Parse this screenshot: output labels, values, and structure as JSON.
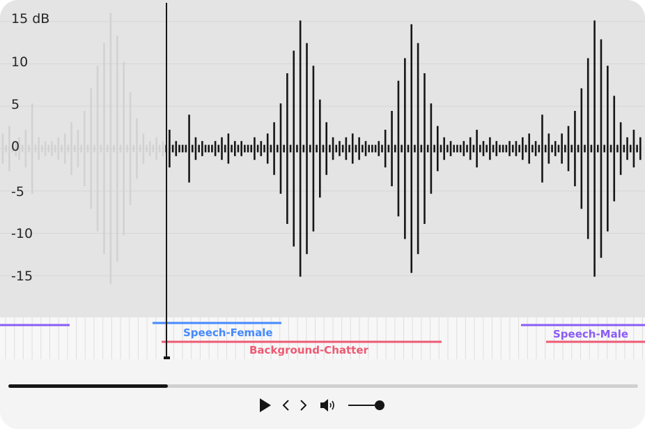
{
  "waveform": {
    "y_axis_labels": [
      {
        "text": "15 dB",
        "value": 15
      },
      {
        "text": "10",
        "value": 10
      },
      {
        "text": "5",
        "value": 5
      },
      {
        "text": "0",
        "value": 0
      },
      {
        "text": "-5",
        "value": -5
      },
      {
        "text": "-10",
        "value": -10
      },
      {
        "text": "-15",
        "value": -15
      }
    ],
    "played_color": "#d2d2d2",
    "unplayed_color": "#161616",
    "background_color": "#e4e4e4",
    "playhead_position": 0.255,
    "amplitudes": [
      4,
      1,
      6,
      1,
      2,
      3,
      1,
      5,
      1,
      12,
      1,
      3,
      1,
      2,
      1,
      2,
      1,
      3,
      1,
      4,
      1,
      7,
      1,
      5,
      1,
      10,
      1,
      16,
      1,
      22,
      1,
      28,
      1,
      36,
      1,
      30,
      1,
      23,
      1,
      15,
      1,
      8,
      1,
      4,
      1,
      2,
      1,
      3,
      1,
      2,
      1,
      5,
      1,
      2,
      1,
      1,
      1,
      9,
      1,
      3,
      1,
      2,
      1,
      1,
      1,
      2,
      1,
      3,
      1,
      4,
      1,
      2,
      1,
      2,
      1,
      1,
      1,
      3,
      1,
      2,
      1,
      4,
      1,
      7,
      1,
      12,
      1,
      20,
      1,
      26,
      1,
      34,
      1,
      28,
      1,
      22,
      1,
      13,
      1,
      7,
      1,
      3,
      1,
      2,
      1,
      3,
      1,
      4,
      1,
      3,
      1,
      2,
      1,
      1,
      1,
      2,
      1,
      5,
      1,
      10,
      1,
      18,
      1,
      24,
      1,
      33,
      1,
      28,
      1,
      20,
      1,
      12,
      1,
      6,
      1,
      3,
      1,
      2,
      1,
      1,
      1,
      2,
      1,
      3,
      1,
      5,
      1,
      2,
      1,
      3,
      1,
      2,
      1,
      1,
      1,
      2,
      1,
      2,
      1,
      3,
      1,
      4,
      1,
      2,
      1,
      9,
      1,
      4,
      1,
      2,
      1,
      4,
      1,
      6,
      1,
      10,
      1,
      16,
      1,
      24,
      1,
      34,
      1,
      29,
      1,
      22,
      1,
      14,
      1,
      7,
      1,
      3,
      1,
      5,
      1,
      3
    ]
  },
  "timeline": {
    "labels": [
      {
        "text": "Speech-Female",
        "color": "#4589ff"
      },
      {
        "text": "Background-Chatter",
        "color": "#ee5a73"
      },
      {
        "text": "Speech-Male",
        "color": "#8a5cf6"
      }
    ],
    "untitled_segment_color": "#8a5cf6"
  },
  "player": {
    "progress": 0.253,
    "volume": 1.0,
    "icons": {
      "play": "play-icon",
      "previous": "chevron-left-icon",
      "next": "chevron-right-icon",
      "volume": "volume-icon"
    }
  }
}
